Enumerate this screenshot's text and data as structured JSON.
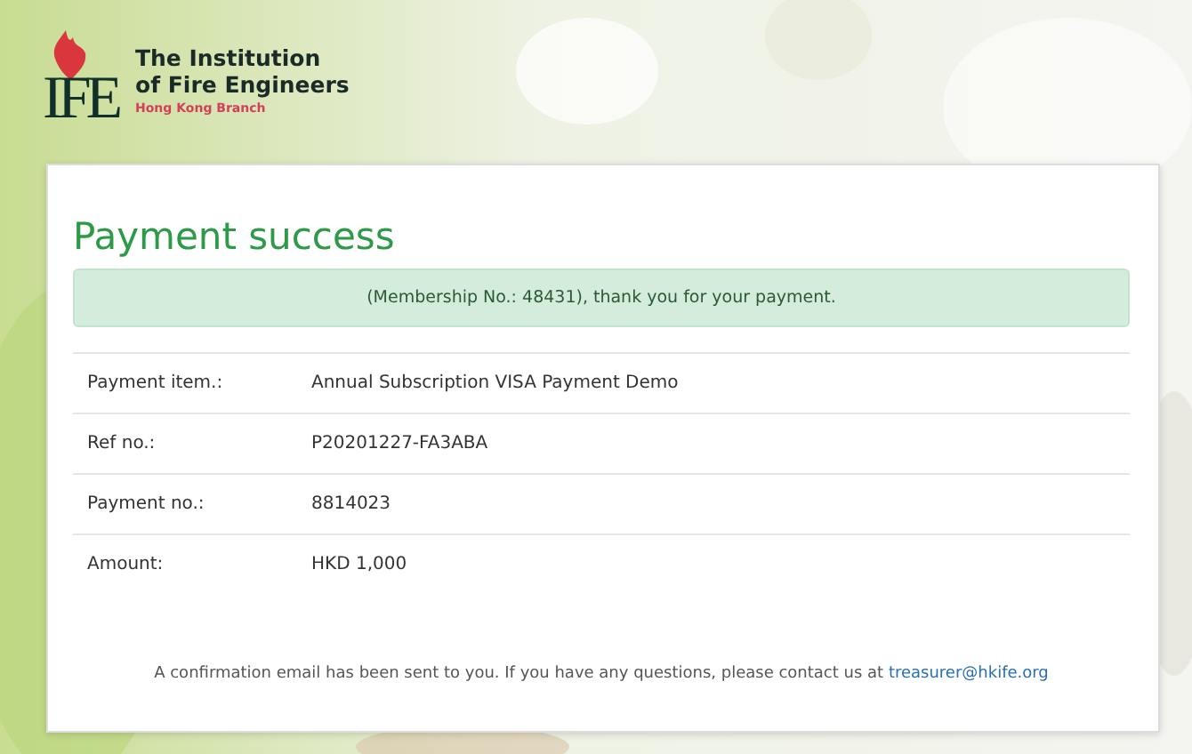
{
  "logo": {
    "mark": "IFE",
    "name_line_1": "The Institution",
    "name_line_2": "of Fire Engineers",
    "branch": "Hong Kong Branch"
  },
  "card": {
    "title": "Payment success",
    "alert": "(Membership No.: 48431), thank you for your payment.",
    "rows": [
      {
        "label": "Payment item.:",
        "value": "Annual Subscription VISA Payment Demo"
      },
      {
        "label": "Ref no.:",
        "value": "P20201227-FA3ABA"
      },
      {
        "label": "Payment no.:",
        "value": "8814023"
      },
      {
        "label": "Amount:",
        "value": "HKD 1,000"
      }
    ],
    "footer_text": "A confirmation email has been sent to you. If you have any questions, please contact us at",
    "footer_link": "treasurer@hkife.org"
  }
}
